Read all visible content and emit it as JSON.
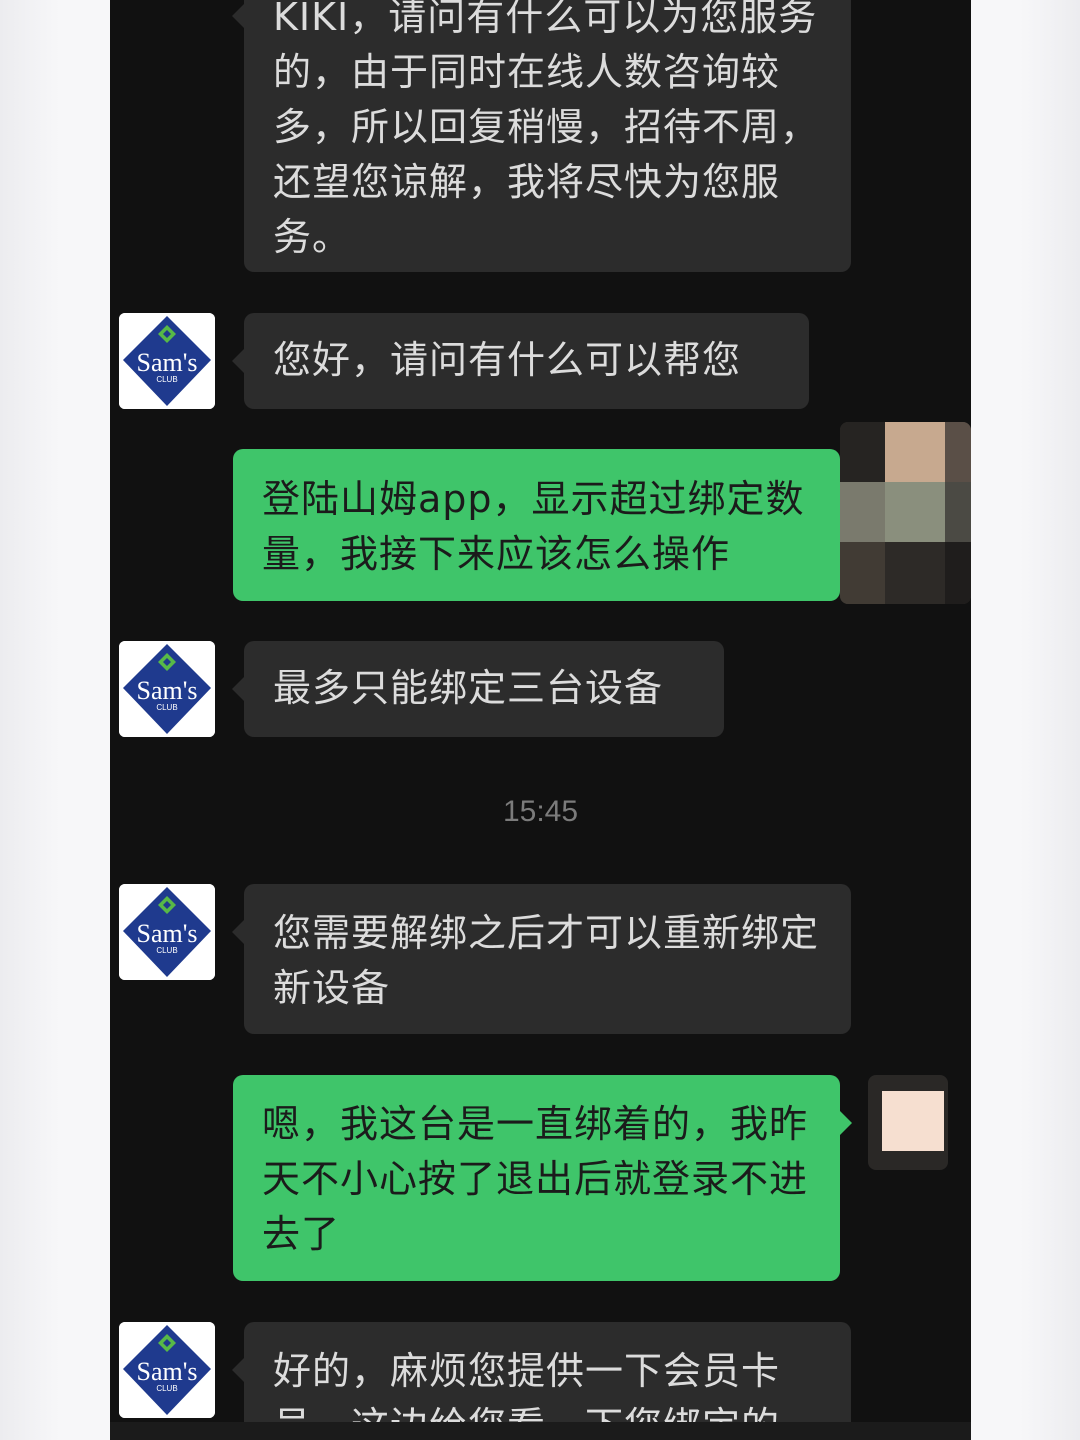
{
  "chat": {
    "messages": [
      {
        "from": "agent",
        "avatar": "sams-club-logo-icon",
        "text": "KIKI，请问有什么可以为您服务的，由于同时在线人数咨询较多，所以回复稍慢，招待不周，还望您谅解，我将尽快为您服务。"
      },
      {
        "from": "agent",
        "avatar": "sams-club-logo-icon",
        "text": "您好，请问有什么可以帮您"
      },
      {
        "from": "user",
        "avatar": "blurred-user-avatar",
        "text": "登陆山姆app，显示超过绑定数量，我接下来应该怎么操作"
      },
      {
        "from": "agent",
        "avatar": "sams-club-logo-icon",
        "text": "最多只能绑定三台设备"
      },
      {
        "from": "agent",
        "avatar": "sams-club-logo-icon",
        "text": "您需要解绑之后才可以重新绑定新设备"
      },
      {
        "from": "user",
        "avatar": "blurred-user-avatar",
        "text": "嗯，我这台是一直绑着的，我昨天不小心按了退出后就登录不进去了"
      },
      {
        "from": "agent",
        "avatar": "sams-club-logo-icon",
        "text": "好的，麻烦您提供一下会员卡号，这边给您看一下您绑定的"
      }
    ],
    "timestamp": "15:45"
  },
  "logo": {
    "brand_text": "Sam's",
    "sub_text": "CLUB",
    "tiny_text": "山姆会员商店",
    "colors": {
      "navy": "#1f3a8e",
      "green": "#58b947",
      "white": "#ffffff"
    }
  },
  "colors": {
    "background": "#111111",
    "agent_bubble": "#2c2c2c",
    "agent_text": "#dcdcdc",
    "user_bubble": "#3fc56a",
    "user_text": "#1b1b1b",
    "timestamp": "#7b7b7b"
  }
}
